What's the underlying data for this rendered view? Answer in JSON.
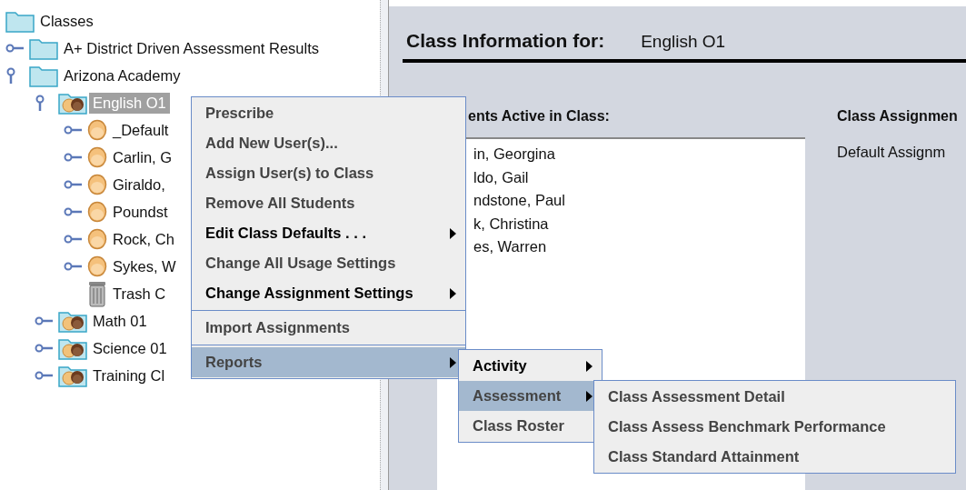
{
  "tree": {
    "label": "Classes",
    "kind": "folder",
    "selected": false,
    "children": [
      {
        "label": "A+ District Driven Assessment Results",
        "kind": "folder",
        "selected": false,
        "expanded": false
      },
      {
        "label": "Arizona Academy",
        "kind": "folder",
        "selected": false,
        "expanded": true,
        "children": [
          {
            "label": "English O1",
            "kind": "class",
            "selected": true,
            "expanded": true,
            "children": [
              {
                "label": "_Default",
                "kind": "student",
                "selected": false,
                "expanded": false
              },
              {
                "label": "Carlin, G",
                "kind": "student",
                "selected": false,
                "expanded": false
              },
              {
                "label": "Giraldo,",
                "kind": "student",
                "selected": false,
                "expanded": false
              },
              {
                "label": "Poundst",
                "kind": "student",
                "selected": false,
                "expanded": false
              },
              {
                "label": "Rock, Ch",
                "kind": "student",
                "selected": false,
                "expanded": false
              },
              {
                "label": "Sykes, W",
                "kind": "student",
                "selected": false,
                "expanded": false
              },
              {
                "label": "Trash C",
                "kind": "trash",
                "selected": false
              }
            ]
          },
          {
            "label": "Math 01",
            "kind": "class",
            "selected": false,
            "expanded": false
          },
          {
            "label": "Science 01",
            "kind": "class",
            "selected": false,
            "expanded": false
          },
          {
            "label": "Training Cl",
            "kind": "class",
            "selected": false,
            "expanded": false
          }
        ]
      }
    ]
  },
  "info": {
    "heading": "Class Information for:",
    "class_name": "English O1",
    "students_heading": "ents Active in Class:",
    "students": [
      "in, Georgina",
      "ldo, Gail",
      "ndstone, Paul",
      "k, Christina",
      "es, Warren"
    ],
    "assignments_heading": "Class Assignmen",
    "assignments": [
      "Default Assignm"
    ]
  },
  "menus": [
    {
      "items": [
        {
          "label": "Prescribe",
          "strong": false,
          "selected": false,
          "submenu": false
        },
        {
          "label": "Add New User(s)...",
          "strong": false,
          "selected": false,
          "submenu": false
        },
        {
          "label": "Assign User(s) to Class",
          "strong": false,
          "selected": false,
          "submenu": false
        },
        {
          "label": "Remove All Students",
          "strong": false,
          "selected": false,
          "submenu": false
        },
        {
          "label": "Edit Class Defaults . . .",
          "strong": true,
          "selected": false,
          "submenu": true
        },
        {
          "label": "Change All Usage Settings",
          "strong": false,
          "selected": false,
          "submenu": false
        },
        {
          "label": "Change Assignment Settings",
          "strong": true,
          "selected": false,
          "submenu": true,
          "separator_after": true
        },
        {
          "label": "Import Assignments",
          "strong": false,
          "selected": false,
          "submenu": false,
          "separator_after": true
        },
        {
          "label": "Reports",
          "strong": false,
          "selected": true,
          "submenu": true
        }
      ]
    },
    {
      "items": [
        {
          "label": "Activity",
          "strong": true,
          "selected": false,
          "submenu": true
        },
        {
          "label": "Assessment",
          "strong": false,
          "selected": true,
          "submenu": true
        },
        {
          "label": "Class Roster",
          "strong": false,
          "selected": false,
          "submenu": false
        }
      ]
    },
    {
      "items": [
        {
          "label": "Class Assessment Detail",
          "strong": false,
          "selected": false,
          "submenu": false
        },
        {
          "label": "Class Assess Benchmark Performance",
          "strong": false,
          "selected": false,
          "submenu": false
        },
        {
          "label": "Class Standard Attainment",
          "strong": false,
          "selected": false,
          "submenu": false
        }
      ]
    }
  ]
}
